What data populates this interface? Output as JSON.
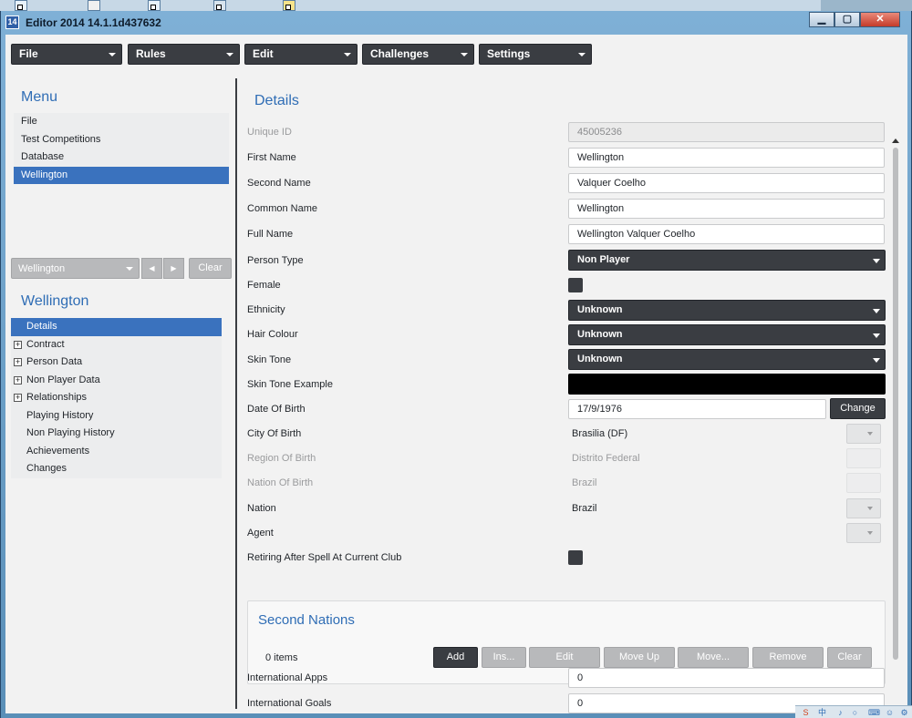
{
  "window": {
    "title": "Editor 2014 14.1.1d437632",
    "logo_text": "14",
    "minimize_glyph": "▁",
    "maximize_glyph": "▢",
    "close_glyph": "✕"
  },
  "menubar": [
    {
      "label": "File"
    },
    {
      "label": "Rules"
    },
    {
      "label": "Edit"
    },
    {
      "label": "Challenges"
    },
    {
      "label": "Settings"
    }
  ],
  "left": {
    "menu_title": "Menu",
    "menu_items": [
      {
        "label": "File",
        "selected": false
      },
      {
        "label": "Test Competitions",
        "selected": false
      },
      {
        "label": "Database",
        "selected": false
      },
      {
        "label": "Wellington",
        "selected": true
      }
    ],
    "history_combo": "Wellington",
    "prev_glyph": "◀",
    "next_glyph": "▶",
    "clear_label": "Clear",
    "person_title": "Wellington",
    "tree": [
      {
        "label": "Details",
        "selected": true,
        "expandable": false
      },
      {
        "label": "Contract",
        "selected": false,
        "expandable": true
      },
      {
        "label": "Person Data",
        "selected": false,
        "expandable": true
      },
      {
        "label": "Non Player Data",
        "selected": false,
        "expandable": true
      },
      {
        "label": "Relationships",
        "selected": false,
        "expandable": true
      },
      {
        "label": "Playing History",
        "selected": false,
        "expandable": false
      },
      {
        "label": "Non Playing History",
        "selected": false,
        "expandable": false
      },
      {
        "label": "Achievements",
        "selected": false,
        "expandable": false
      },
      {
        "label": "Changes",
        "selected": false,
        "expandable": false
      }
    ]
  },
  "details": {
    "title": "Details",
    "unique_id": {
      "label": "Unique ID",
      "value": "45005236"
    },
    "first_name": {
      "label": "First Name",
      "value": "Wellington"
    },
    "second_name": {
      "label": "Second Name",
      "value": "Valquer Coelho"
    },
    "common_name": {
      "label": "Common Name",
      "value": "Wellington"
    },
    "full_name": {
      "label": "Full Name",
      "value": "Wellington Valquer Coelho"
    },
    "person_type": {
      "label": "Person Type",
      "value": "Non Player"
    },
    "female": {
      "label": "Female",
      "checked": false
    },
    "ethnicity": {
      "label": "Ethnicity",
      "value": "Unknown"
    },
    "hair_colour": {
      "label": "Hair Colour",
      "value": "Unknown"
    },
    "skin_tone": {
      "label": "Skin Tone",
      "value": "Unknown"
    },
    "skin_tone_example": {
      "label": "Skin Tone Example",
      "color": "#000000"
    },
    "date_of_birth": {
      "label": "Date Of Birth",
      "value": "17/9/1976",
      "button": "Change"
    },
    "city_of_birth": {
      "label": "City Of Birth",
      "value": "Brasilia (DF)"
    },
    "region_of_birth": {
      "label": "Region Of Birth",
      "value": "Distrito Federal"
    },
    "nation_of_birth": {
      "label": "Nation Of Birth",
      "value": "Brazil"
    },
    "nation": {
      "label": "Nation",
      "value": "Brazil"
    },
    "agent": {
      "label": "Agent",
      "value": ""
    },
    "retiring": {
      "label": "Retiring After Spell At Current Club",
      "checked": false
    },
    "second_nations": {
      "title": "Second Nations",
      "count": "0 items",
      "buttons": [
        "Add",
        "Ins...",
        "Edit",
        "Move Up",
        "Move...",
        "Remove",
        "Clear"
      ]
    },
    "international_apps": {
      "label": "International Apps",
      "value": "0"
    },
    "international_goals": {
      "label": "International Goals",
      "value": "0"
    }
  },
  "tray": {
    "icons": [
      "S",
      "中",
      "♪",
      "○",
      "⌨",
      "☺",
      "⚙"
    ]
  },
  "colors": {
    "accent_blue": "#2f6db5",
    "selection": "#3a72be",
    "dark_control": "#3a3d42",
    "disabled_control": "#b8b9bb"
  }
}
